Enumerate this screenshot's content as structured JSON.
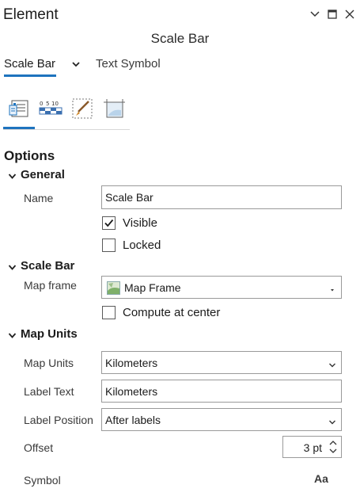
{
  "pane": {
    "title": "Element",
    "element_name": "Scale Bar"
  },
  "type_tabs": {
    "active": "Scale Bar",
    "other": "Text Symbol"
  },
  "icon_tabs": [
    "options-icon",
    "scale-bar-properties-icon",
    "symbol-icon",
    "display-icon"
  ],
  "options": {
    "title": "Options",
    "general": {
      "header": "General",
      "name_label": "Name",
      "name_value": "Scale Bar",
      "visible_label": "Visible",
      "visible_checked": true,
      "locked_label": "Locked",
      "locked_checked": false
    },
    "scale_bar": {
      "header": "Scale Bar",
      "map_frame_label": "Map frame",
      "map_frame_value": "Map Frame",
      "compute_center_label": "Compute at center",
      "compute_center_checked": false
    },
    "map_units": {
      "header": "Map Units",
      "units_label": "Map Units",
      "units_value": "Kilometers",
      "label_text_label": "Label Text",
      "label_text_value": "Kilometers",
      "label_position_label": "Label Position",
      "label_position_value": "After labels",
      "offset_label": "Offset",
      "offset_value": "3 pt",
      "symbol_label": "Symbol",
      "symbol_glyph": "Aa"
    }
  },
  "colors": {
    "accent": "#1e73be"
  }
}
